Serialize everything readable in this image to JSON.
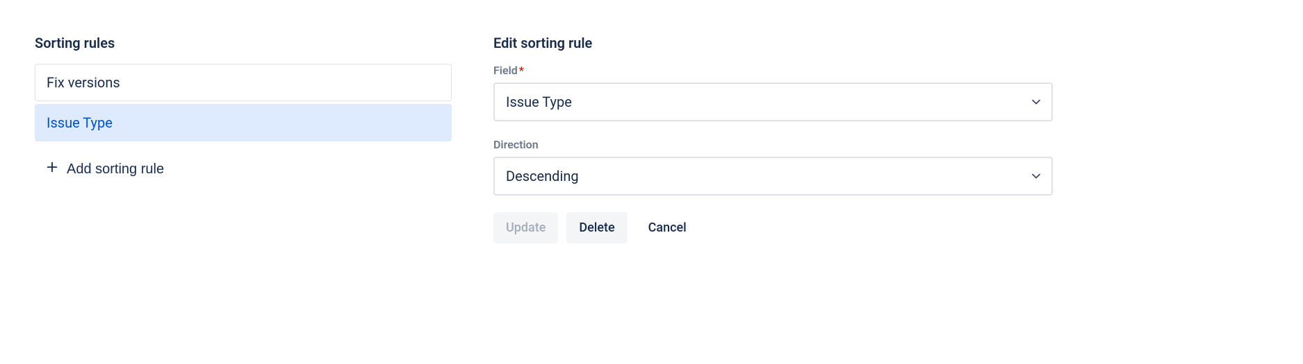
{
  "left": {
    "heading": "Sorting rules",
    "rules": [
      {
        "label": "Fix versions",
        "selected": false
      },
      {
        "label": "Issue Type",
        "selected": true
      }
    ],
    "addLabel": "Add sorting rule"
  },
  "right": {
    "heading": "Edit sorting rule",
    "fieldLabel": "Field",
    "fieldRequired": "*",
    "fieldValue": "Issue Type",
    "directionLabel": "Direction",
    "directionValue": "Descending",
    "buttons": {
      "update": "Update",
      "delete": "Delete",
      "cancel": "Cancel"
    }
  }
}
